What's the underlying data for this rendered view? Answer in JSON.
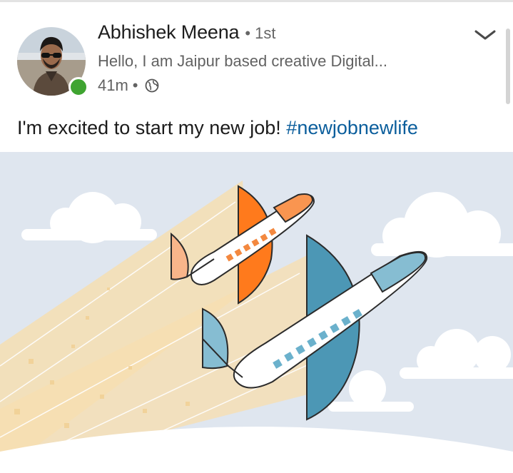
{
  "post": {
    "author_name": "Abhishek Meena",
    "connection_degree": "• 1st",
    "headline": "Hello, I am Jaipur based creative Digital...",
    "time": "41m",
    "meta_separator": "•",
    "visibility_icon": "globe-icon",
    "text": "I'm excited to start my new job! ",
    "hashtag": "#newjobnewlife",
    "online_status": "online"
  },
  "colors": {
    "online_green": "#3fa431",
    "hashtag_blue": "#0b5e9c",
    "orange_plane": "#ff7a1c",
    "blue_plane": "#4c97b5",
    "sky": "#dfe6ef",
    "trail": "#f6deb2"
  }
}
